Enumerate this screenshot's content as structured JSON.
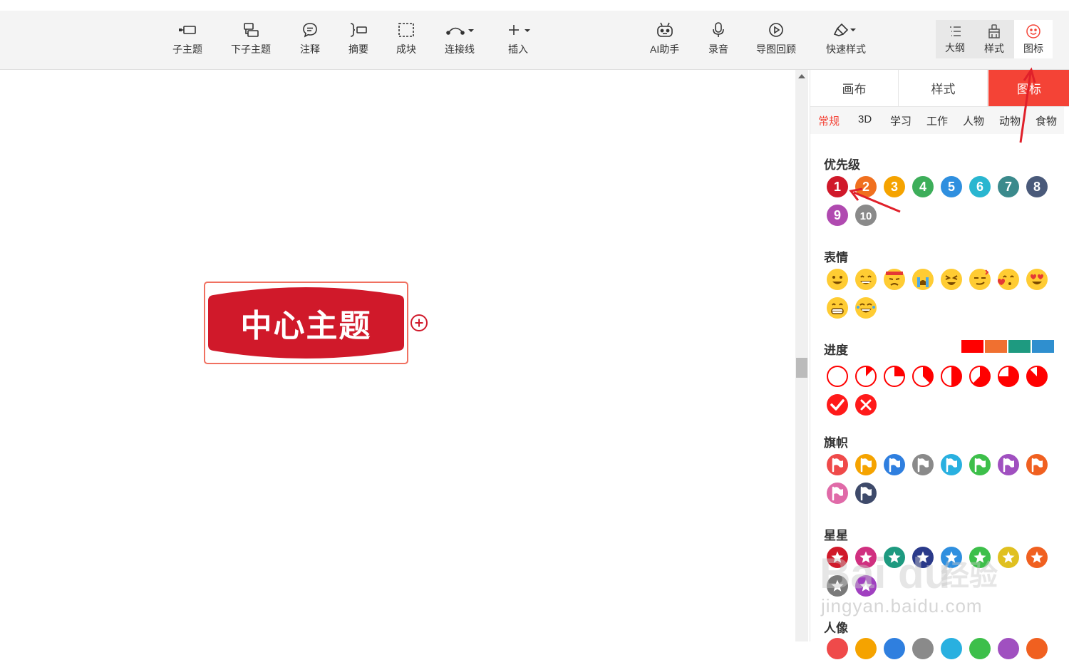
{
  "toolbar": {
    "items": [
      {
        "label": "子主题",
        "icon": "subtopic-icon"
      },
      {
        "label": "下子主题",
        "icon": "child-subtopic-icon"
      },
      {
        "label": "注释",
        "icon": "comment-icon"
      },
      {
        "label": "摘要",
        "icon": "summary-icon"
      },
      {
        "label": "成块",
        "icon": "boundary-icon"
      },
      {
        "label": "连接线",
        "icon": "connector-icon"
      },
      {
        "label": "插入",
        "icon": "insert-icon"
      },
      {
        "label": "AI助手",
        "icon": "robot-icon"
      },
      {
        "label": "录音",
        "icon": "microphone-icon"
      },
      {
        "label": "导图回顾",
        "icon": "play-icon"
      },
      {
        "label": "快速样式",
        "icon": "brush-icon"
      }
    ],
    "view_buttons": [
      {
        "label": "大纲",
        "icon": "outline-icon"
      },
      {
        "label": "样式",
        "icon": "style-icon"
      },
      {
        "label": "图标",
        "icon": "smiley-icon"
      }
    ]
  },
  "canvas": {
    "center_topic": "中心主题",
    "topic_color": "#d0192a"
  },
  "panel": {
    "tabs": [
      "画布",
      "样式",
      "图标"
    ],
    "active_tab": "图标",
    "categories": [
      "常规",
      "3D",
      "学习",
      "工作",
      "人物",
      "动物",
      "食物"
    ],
    "active_category": "常规",
    "sections": {
      "priority": {
        "title": "优先级",
        "items": [
          {
            "num": "1",
            "color": "#d0192a"
          },
          {
            "num": "2",
            "color": "#f0701f"
          },
          {
            "num": "3",
            "color": "#f5a300"
          },
          {
            "num": "4",
            "color": "#3dae5a"
          },
          {
            "num": "5",
            "color": "#2f8fdf"
          },
          {
            "num": "6",
            "color": "#29b6d0"
          },
          {
            "num": "7",
            "color": "#3b8a8c"
          },
          {
            "num": "8",
            "color": "#4a5a7a"
          },
          {
            "num": "9",
            "color": "#b04ab0"
          },
          {
            "num": "10",
            "color": "#8a8a8a"
          }
        ]
      },
      "emotion": {
        "title": "表情"
      },
      "progress": {
        "title": "进度",
        "colors": [
          "#ff0000",
          "#f07030",
          "#1e9a80",
          "#2f8fcf"
        ],
        "levels": [
          0,
          0.125,
          0.25,
          0.375,
          0.5,
          0.625,
          0.75,
          0.875
        ]
      },
      "flags": {
        "title": "旗帜",
        "colors": [
          "#ef4a4a",
          "#f5a300",
          "#2f7fdf",
          "#8a8a8a",
          "#29b0e0",
          "#3dbf4a",
          "#a050c0",
          "#f06020",
          "#e06aa8",
          "#3e4a6a"
        ]
      },
      "stars": {
        "title": "星星",
        "colors": [
          "#d0192a",
          "#d03080",
          "#1e9a80",
          "#2a3a8a",
          "#2f8fdf",
          "#3dbf4a",
          "#e0c020",
          "#f06020",
          "#7a7a7a",
          "#a040c0"
        ]
      },
      "people": {
        "title": "人像"
      }
    }
  },
  "watermark": {
    "text": "jingyan.baidu.com",
    "brand": "Bai du",
    "brand_cn": "经验"
  }
}
